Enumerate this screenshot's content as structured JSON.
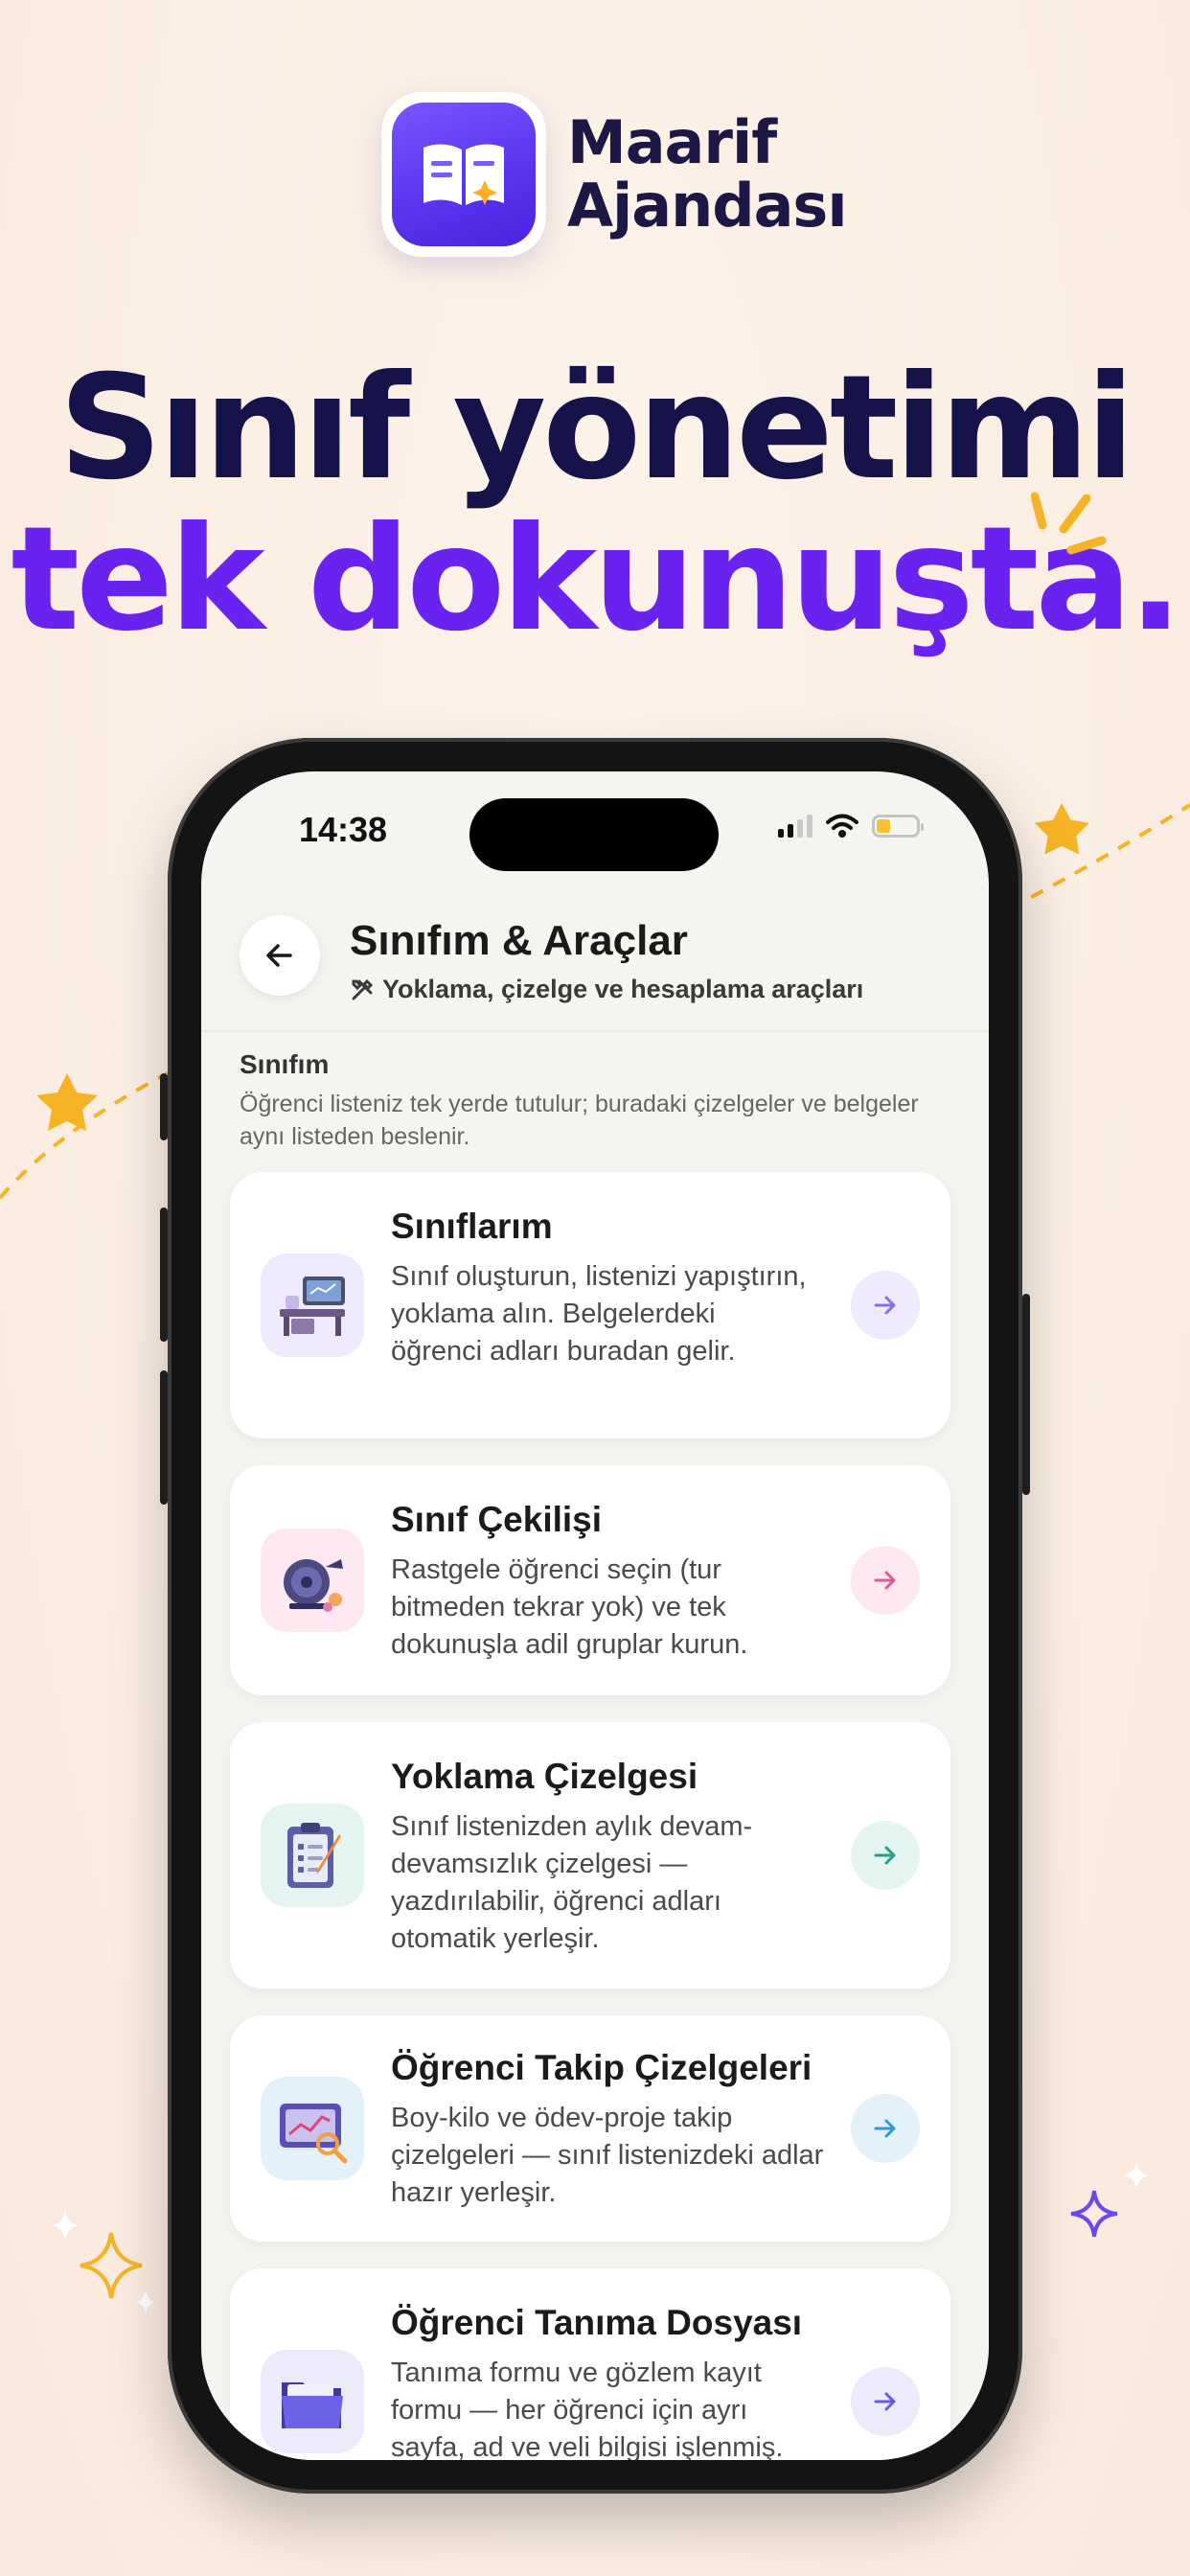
{
  "brand": {
    "name_line1": "Maarif",
    "name_line2": "Ajandası"
  },
  "headline": {
    "line1": "Sınıf yönetimi",
    "line2": "tek dokunuşta."
  },
  "status_bar": {
    "time": "14:38"
  },
  "header": {
    "title": "Sınıfım & Araçlar",
    "subtitle": "Yoklama, çizelge ve hesaplama araçları"
  },
  "section": {
    "title": "Sınıfım",
    "description": "Öğrenci listeniz tek yerde tutulur; buradaki çizelgeler ve belgeler aynı listeden beslenir."
  },
  "cards": [
    {
      "title": "Sınıflarım",
      "description": "Sınıf oluşturun, listenizi yapıştırın, yoklama alın. Belgelerdeki öğrenci adları buradan gelir.",
      "icon": "classroom-desk-icon",
      "accent": "#8a6cf0",
      "tint": "#efeafd"
    },
    {
      "title": "Sınıf Çekilişi",
      "description": "Rastgele öğrenci seçin (tur bitmeden tekrar yok) ve tek dokunuşla adil gruplar kurun.",
      "icon": "raffle-drum-icon",
      "accent": "#e05a9a",
      "tint": "#fde8f1"
    },
    {
      "title": "Yoklama Çizelgesi",
      "description": "Sınıf listenizden aylık devam-devamsızlık çizelgesi — yazdırılabilir, öğrenci adları otomatik yerleşir.",
      "icon": "clipboard-icon",
      "accent": "#2a9c8c",
      "tint": "#e3f4f1"
    },
    {
      "title": "Öğrenci Takip Çizelgeleri",
      "description": "Boy-kilo ve ödev-proje takip çizelgeleri — sınıf listenizdeki adlar hazır yerleşir.",
      "icon": "chart-screen-icon",
      "accent": "#2a9ad8",
      "tint": "#e3f1fb"
    },
    {
      "title": "Öğrenci Tanıma Dosyası",
      "description": "Tanıma formu ve gözlem kayıt formu — her öğrenci için ayrı sayfa, ad ve veli bilgisi işlenmiş.",
      "icon": "folder-icon",
      "accent": "#6a5ae0",
      "tint": "#ecebfb"
    }
  ]
}
